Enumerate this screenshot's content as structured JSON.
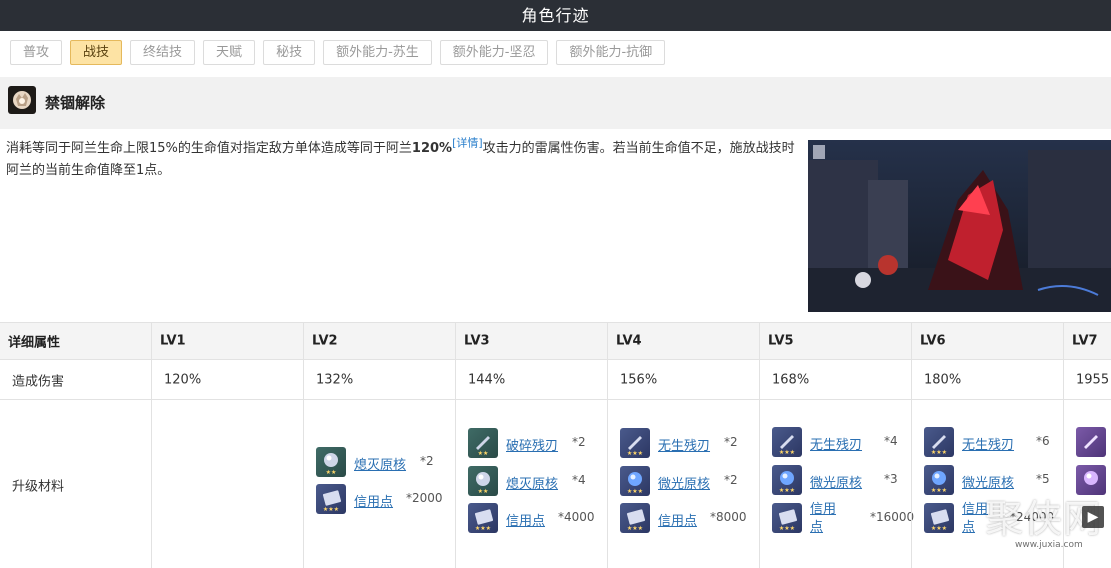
{
  "header": {
    "title": "角色行迹"
  },
  "tabs": [
    {
      "label": "普攻",
      "active": false
    },
    {
      "label": "战技",
      "active": true
    },
    {
      "label": "终结技",
      "active": false
    },
    {
      "label": "天赋",
      "active": false
    },
    {
      "label": "秘技",
      "active": false
    },
    {
      "label": "额外能力-苏生",
      "active": false
    },
    {
      "label": "额外能力-坚忍",
      "active": false
    },
    {
      "label": "额外能力-抗御",
      "active": false
    }
  ],
  "skill": {
    "name": "禁锢解除",
    "desc_part1": "消耗等同于阿兰生命上限15%的生命值对指定敌方单体造成等同于阿兰",
    "desc_bold": "120%",
    "desc_detail_link": "[详情]",
    "desc_part2": "攻击力的雷属性伤害。若当前生命值不足，施放战技时阿兰的当前生命值降至1点。"
  },
  "table": {
    "header_label": "详细属性",
    "levels": [
      "LV1",
      "LV2",
      "LV3",
      "LV4",
      "LV5",
      "LV6",
      "LV7"
    ],
    "damage_label": "造成伤害",
    "damage_values": [
      "120%",
      "132%",
      "144%",
      "156%",
      "168%",
      "180%",
      "1955"
    ],
    "materials_label": "升级材料",
    "materials": [
      [],
      [
        {
          "name": "熄灭原核",
          "qty": "*2",
          "icon": "core-orb-icon",
          "stars": "★★"
        },
        {
          "name": "信用点",
          "qty": "*2000",
          "icon": "credit-card-icon",
          "stars": "★★★"
        }
      ],
      [
        {
          "name": "破碎残刃",
          "qty": "*2",
          "icon": "broken-blade-icon",
          "stars": "★★"
        },
        {
          "name": "熄灭原核",
          "qty": "*4",
          "icon": "core-orb-icon",
          "stars": "★★"
        },
        {
          "name": "信用点",
          "qty": "*4000",
          "icon": "credit-card-icon",
          "stars": "★★★"
        }
      ],
      [
        {
          "name": "无生残刃",
          "qty": "*2",
          "icon": "broken-blade-icon",
          "stars": "★★★"
        },
        {
          "name": "微光原核",
          "qty": "*2",
          "icon": "core-orb-icon",
          "stars": "★★★"
        },
        {
          "name": "信用点",
          "qty": "*8000",
          "icon": "credit-card-icon",
          "stars": "★★★"
        }
      ],
      [
        {
          "name": "无生残刃",
          "qty": "*4",
          "icon": "broken-blade-icon",
          "stars": "★★★"
        },
        {
          "name": "微光原核",
          "qty": "*3",
          "icon": "core-orb-icon",
          "stars": "★★★"
        },
        {
          "name": "信用点",
          "qty": "*16000",
          "icon": "credit-card-icon",
          "stars": "★★★"
        }
      ],
      [
        {
          "name": "无生残刃",
          "qty": "*6",
          "icon": "broken-blade-icon",
          "stars": "★★★"
        },
        {
          "name": "微光原核",
          "qty": "*5",
          "icon": "core-orb-icon",
          "stars": "★★★"
        },
        {
          "name": "信用点",
          "qty": "*24000",
          "icon": "credit-card-icon",
          "stars": "★★★"
        }
      ]
    ]
  },
  "watermark": {
    "text": "聚侠网",
    "url": "www.juxia.com"
  },
  "icons": {
    "skill": "skill-fist-icon",
    "next": "next-arrow-icon"
  },
  "colors": {
    "titlebar": "#2b2f36",
    "active_tab": "#fde3a4",
    "link": "#2a6fb2"
  }
}
